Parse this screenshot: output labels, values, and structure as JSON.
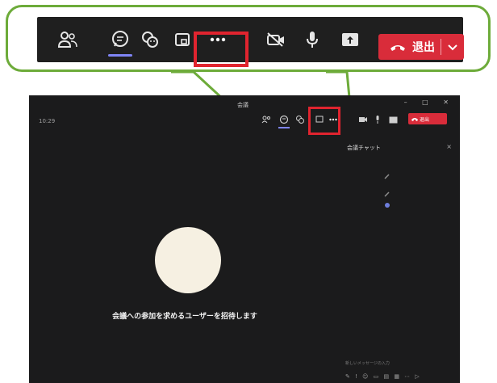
{
  "callout_toolbar": {
    "leave_label": "退出"
  },
  "meeting_window": {
    "title": "会議",
    "time": "10:29",
    "window_controls": "–  □  ✕",
    "leave_label": "退出",
    "chat_panel": {
      "title": "会議チャット",
      "close": "×",
      "input_placeholder": "新しいメッセージの入力",
      "tools": "✎ ! ☺ ▭ ▤ ▦ ⋯ ▷"
    },
    "invite_message": "会議への参加を求めるユーザーを招待します"
  },
  "colors": {
    "callout_border": "#6dab3a",
    "highlight": "#e0242f",
    "leave": "#d92c3a",
    "active_underline": "#7f85f5"
  }
}
